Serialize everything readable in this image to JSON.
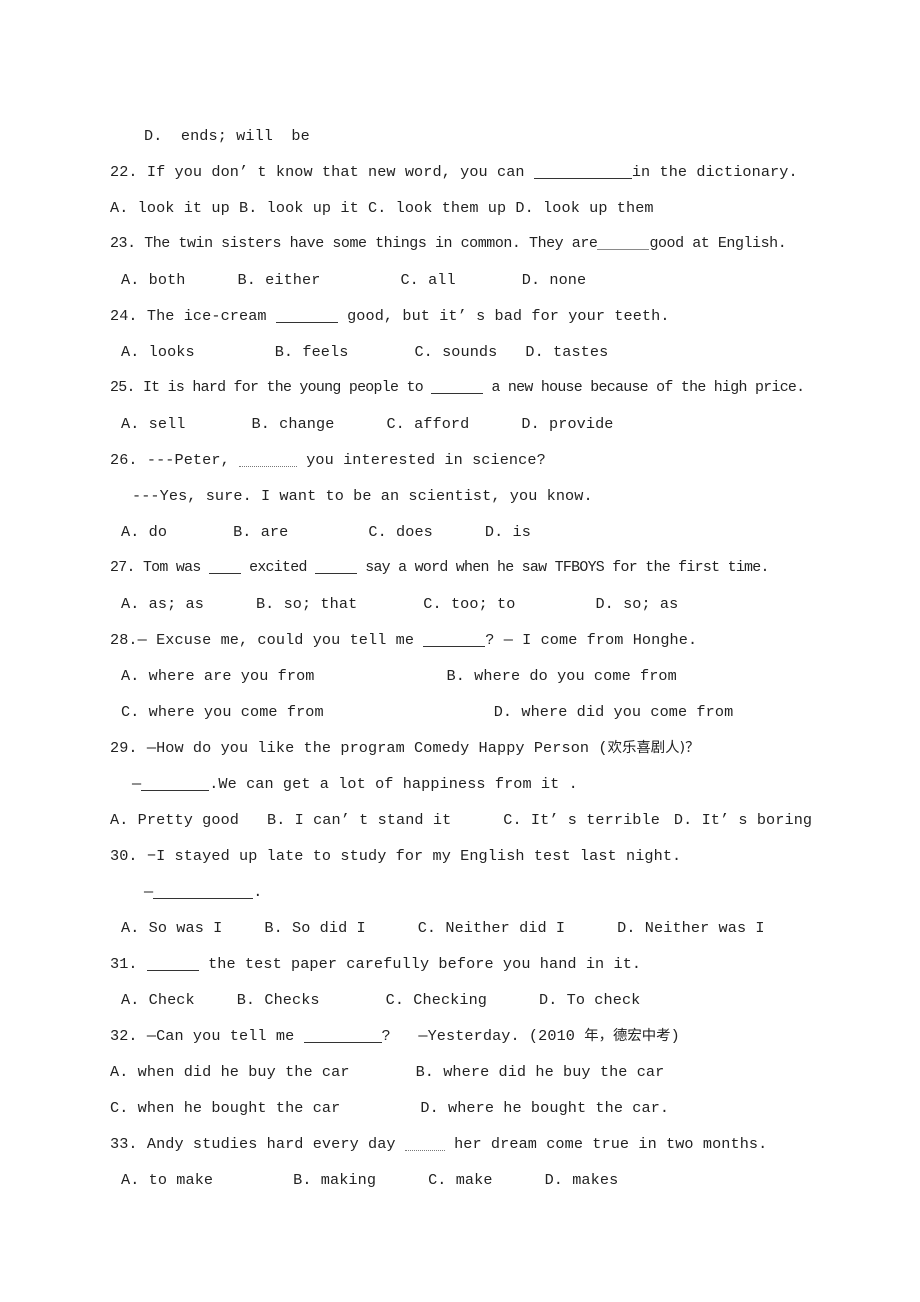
{
  "document": {
    "type": "english-exam-multiple-choice",
    "page_background": "#ffffff",
    "text_color": "#222222"
  },
  "lines": {
    "l01_prev_option_d": "D.  ends; will  be",
    "q22": {
      "stem_a": "22. If you don’ t know that new word, you can ",
      "stem_b": "in the dictionary.",
      "options": "A. look it up B. look up it C. look them up D. look up them"
    },
    "q23": {
      "stem_a": "23. The twin sisters have some things in common. They are",
      "stem_b": "good at English.",
      "opt_a": "A. both",
      "opt_b": "B. either",
      "opt_c": "C. all",
      "opt_d": "D. none"
    },
    "q24": {
      "stem_a": "24. The ice-cream ",
      "stem_b": " good, but it’ s bad for your teeth.",
      "opt_a": "A. looks",
      "opt_b": "B. feels",
      "opt_c": "C. sounds",
      "opt_d": "D. tastes"
    },
    "q25": {
      "stem_a": "25. It is hard for the young people to ",
      "stem_b": " a new house because of the high price.",
      "opt_a": "A. sell",
      "opt_b": "B. change",
      "opt_c": "C. afford",
      "opt_d": "D. provide"
    },
    "q26": {
      "stem_a": "26. ---Peter, ",
      "stem_b": " you interested in science?",
      "reply": "---Yes, sure. I want to be an scientist, you know.",
      "opt_a": "A. do",
      "opt_b": "B. are",
      "opt_c": "C. does",
      "opt_d": "D. is"
    },
    "q27": {
      "stem_a": "27. Tom was ",
      "stem_b": " excited ",
      "stem_c": " say a word when he saw TFBOYS for the first time.",
      "opt_a": "A. as; as",
      "opt_b": "B. so; that",
      "opt_c": "C. too; to",
      "opt_d": "D. so; as"
    },
    "q28": {
      "stem_a": "28.— Excuse me, could you tell me ",
      "stem_b": "? — I come from Honghe.",
      "opt_a": "A. where are you from",
      "opt_b": "B. where do you come from",
      "opt_c": "C. where you come from",
      "opt_d": "D. where did you come from"
    },
    "q29": {
      "stem": "29. —How do you like the program Comedy Happy Person (",
      "stem_cn": "欢乐喜剧人",
      "stem_end": ")？",
      "reply_a": "—",
      "reply_b": ".We can get a lot of happiness from it .",
      "opt_a": "A. Pretty good",
      "opt_b": "B. I can’ t stand it",
      "opt_c": "C. It’ s terrible",
      "opt_d": "D. It’ s boring"
    },
    "q30": {
      "stem": "30. −I stayed up late to study for my English test last night.",
      "reply_a": "—",
      "reply_b": ".",
      "opt_a": "A. So was I",
      "opt_b": "B. So did I",
      "opt_c": "C. Neither did I",
      "opt_d": "D. Neither was I"
    },
    "q31": {
      "stem_a": "31. ",
      "stem_b": " the test paper carefully before you hand in it.",
      "opt_a": "A. Check",
      "opt_b": "B. Checks",
      "opt_c": "C. Checking",
      "opt_d": "D. To check"
    },
    "q32": {
      "stem_a": "32. —Can you tell me ",
      "stem_b": "?   —Yesterday. (2010 ",
      "stem_cn": "年，德宏中考",
      "stem_end": ")",
      "opt_a": "A. when did he buy the car",
      "opt_b": "B. where did he buy the car",
      "opt_c": "C. when he bought the car",
      "opt_d": "D. where he bought the car."
    },
    "q33": {
      "stem_a": "33. Andy studies hard every day ",
      "stem_b": " her dream come true in two months.",
      "opt_a": "A. to make",
      "opt_b": "B. making",
      "opt_c": "C. make",
      "opt_d": "D. makes"
    }
  }
}
